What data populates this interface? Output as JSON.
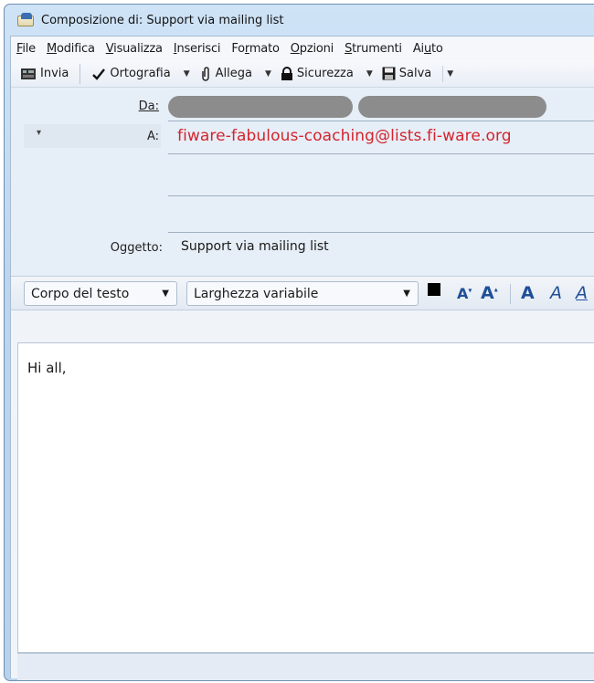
{
  "window": {
    "title": "Composizione di: Support via mailing list"
  },
  "menubar": {
    "items": [
      {
        "pre": "",
        "ul": "F",
        "post": "ile"
      },
      {
        "pre": "",
        "ul": "M",
        "post": "odifica"
      },
      {
        "pre": "",
        "ul": "V",
        "post": "isualizza"
      },
      {
        "pre": "",
        "ul": "I",
        "post": "nserisci"
      },
      {
        "pre": "Fo",
        "ul": "r",
        "post": "mato"
      },
      {
        "pre": "",
        "ul": "O",
        "post": "pzioni"
      },
      {
        "pre": "",
        "ul": "S",
        "post": "trumenti"
      },
      {
        "pre": "Ai",
        "ul": "u",
        "post": "to"
      }
    ]
  },
  "toolbar": {
    "send_label": "Invia",
    "spelling_label": "Ortografia",
    "attach_label": "Allega",
    "security_label": "Sicurezza",
    "save_label": "Salva"
  },
  "headers": {
    "from_label": "Da:",
    "to_label": "A:",
    "to_value": "fiware-fabulous-coaching@lists.fi-ware.org",
    "subject_label": "Oggetto:",
    "subject_value": "Support via mailing list"
  },
  "format": {
    "paragraph_style": "Corpo del testo",
    "font": "Larghezza variabile",
    "smaller_label": "A",
    "larger_label": "A",
    "bold_label": "A",
    "italic_label": "A"
  },
  "body": {
    "text": "Hi all,"
  },
  "colors": {
    "recipient": "#d4242c",
    "accent": "#1f4f98",
    "redacted": "#8c8c8c"
  }
}
